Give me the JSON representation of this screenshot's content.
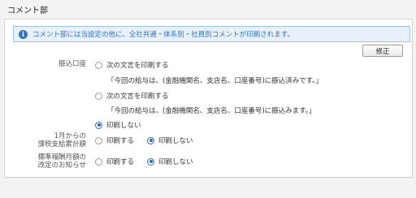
{
  "section": {
    "title": "コメント部"
  },
  "info": {
    "icon": "info-icon",
    "text": "コメント部には当設定の他に、全社共通・体系別・社員別コメントが印刷されます。"
  },
  "toolbar": {
    "edit_label": "修正"
  },
  "transfer": {
    "label": "振込口座",
    "option1": {
      "label": "次の文言を印刷する",
      "message": "「今回の給与は、(金融機関名、支店名、口座番号)に振込済みです。」",
      "selected": false
    },
    "option2": {
      "label": "次の文言を印刷する",
      "message": "「今回の給与は、(金融機関名、支店名、口座番号)に振込みます。」",
      "selected": false
    },
    "option3": {
      "label": "印刷しない",
      "selected": true
    }
  },
  "taxable": {
    "label_line1": "1月からの",
    "label_line2": "課税支給累計額",
    "print_label": "印刷する",
    "noprint_label": "印刷しない",
    "selected": "noprint"
  },
  "standard": {
    "label_line1": "標準報酬月額の",
    "label_line2": "改定のお知らせ",
    "print_label": "印刷する",
    "noprint_label": "印刷しない",
    "selected": "noprint"
  }
}
